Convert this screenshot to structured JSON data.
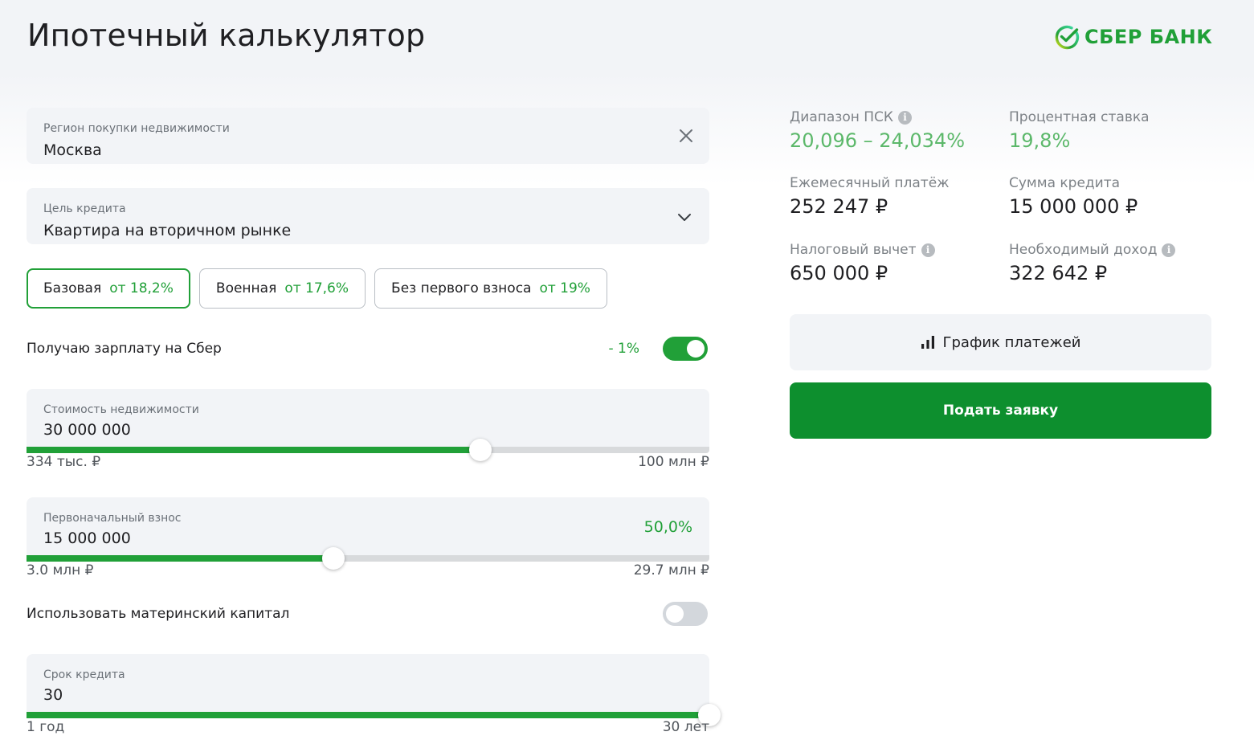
{
  "header": {
    "title": "Ипотечный калькулятор",
    "logo_text": "СБЕР БАНК",
    "brand_color": "#21a038"
  },
  "region": {
    "label": "Регион покупки недвижимости",
    "value": "Москва",
    "clear_icon": "close-icon"
  },
  "purpose": {
    "label": "Цель кредита",
    "value": "Квартира на вторичном рынке",
    "dropdown_icon": "chevron-down-icon"
  },
  "programs": [
    {
      "name": "Базовая",
      "rate": "от 18,2%",
      "active": true
    },
    {
      "name": "Военная",
      "rate": "от 17,6%",
      "active": false
    },
    {
      "name": "Без первого взноса",
      "rate": "от 19%",
      "active": false
    }
  ],
  "salary_toggle": {
    "label": "Получаю зарплату на Сбер",
    "discount": "- 1%",
    "on": true
  },
  "property_cost": {
    "label": "Стоимость недвижимости",
    "value": "30 000 000",
    "min_label": "334 тыс. ₽",
    "max_label": "100 млн ₽",
    "fill_fraction": 0.665
  },
  "down_payment": {
    "label": "Первоначальный взнос",
    "value": "15 000 000",
    "percent": "50,0%",
    "min_label": "3.0 млн ₽",
    "max_label": "29.7 млн ₽",
    "fill_fraction": 0.449
  },
  "maternity_toggle": {
    "label": "Использовать материнский капитал",
    "on": false
  },
  "term": {
    "label": "Срок кредита",
    "value": "30",
    "min_label": "1 год",
    "max_label": "30 лет",
    "fill_fraction": 1.0
  },
  "results": {
    "psk": {
      "label": "Диапазон ПСК",
      "value": "20,096 – 24,034%"
    },
    "rate": {
      "label": "Процентная ставка",
      "value": "19,8%"
    },
    "monthly": {
      "label": "Ежемесячный платёж",
      "value": "252 247 ₽"
    },
    "loan": {
      "label": "Сумма кредита",
      "value": "15 000 000 ₽"
    },
    "tax": {
      "label": "Налоговый вычет",
      "value": "650 000 ₽"
    },
    "income": {
      "label": "Необходимый доход",
      "value": "322 642 ₽"
    }
  },
  "buttons": {
    "schedule": "График платежей",
    "schedule_icon": "bar-chart-icon",
    "apply": "Подать заявку"
  }
}
